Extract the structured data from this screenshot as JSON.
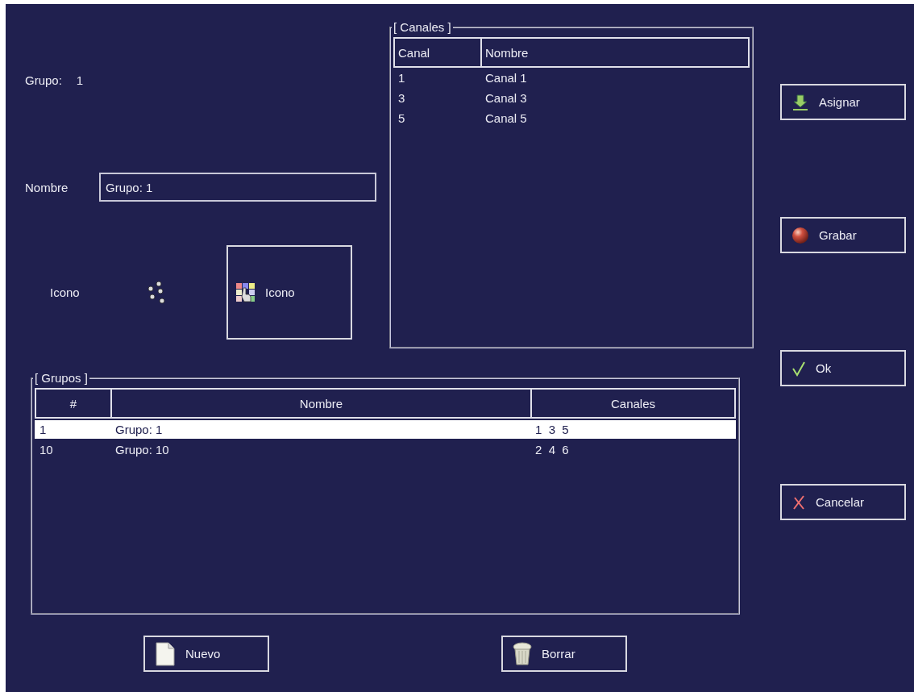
{
  "group_label": {
    "label": "Grupo:",
    "value": "1"
  },
  "name_field": {
    "label": "Nombre",
    "value": "Grupo: 1"
  },
  "icon_row": {
    "label": "Icono",
    "button": "Icono"
  },
  "channels_panel": {
    "title": "[ Canales ]",
    "columns": [
      "Canal",
      "Nombre"
    ],
    "rows": [
      {
        "canal": "1",
        "nombre": "Canal 1"
      },
      {
        "canal": "3",
        "nombre": "Canal 3"
      },
      {
        "canal": "5",
        "nombre": "Canal 5"
      }
    ]
  },
  "groups_panel": {
    "title": "[ Grupos ]",
    "columns": [
      "#",
      "Nombre",
      "Canales"
    ],
    "rows": [
      {
        "id": "1",
        "nombre": "Grupo: 1",
        "canales": "1  3  5",
        "selected": true
      },
      {
        "id": "10",
        "nombre": "Grupo: 10",
        "canales": "2  4  6",
        "selected": false
      }
    ]
  },
  "side_buttons": [
    {
      "label": "Asignar",
      "kind": "assign"
    },
    {
      "label": "Grabar",
      "kind": "save"
    },
    {
      "label": "Ok",
      "kind": "ok"
    },
    {
      "label": "Cancelar",
      "kind": "cancel"
    }
  ],
  "bottom_buttons": [
    {
      "label": "Nuevo",
      "kind": "new"
    },
    {
      "label": "Borrar",
      "kind": "delete"
    }
  ]
}
